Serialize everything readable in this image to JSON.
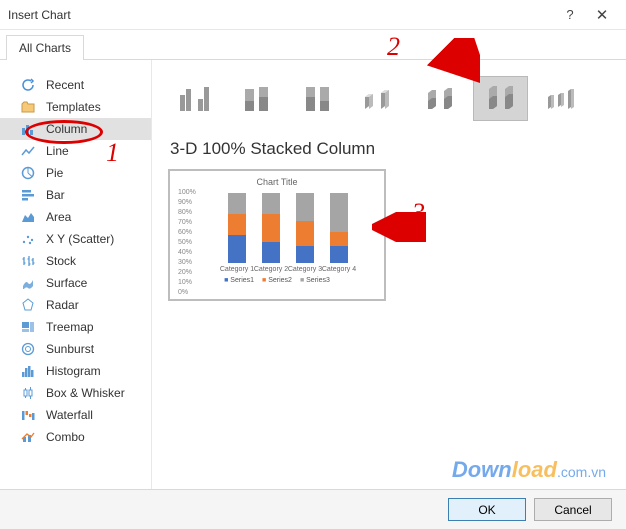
{
  "window": {
    "title": "Insert Chart",
    "help": "?",
    "close": "✕"
  },
  "tabs": [
    {
      "label": "All Charts",
      "active": true
    }
  ],
  "sidebar": {
    "items": [
      {
        "label": "Recent",
        "icon": "recent"
      },
      {
        "label": "Templates",
        "icon": "templates"
      },
      {
        "label": "Column",
        "icon": "column",
        "selected": true
      },
      {
        "label": "Line",
        "icon": "line"
      },
      {
        "label": "Pie",
        "icon": "pie"
      },
      {
        "label": "Bar",
        "icon": "bar"
      },
      {
        "label": "Area",
        "icon": "area"
      },
      {
        "label": "X Y (Scatter)",
        "icon": "scatter"
      },
      {
        "label": "Stock",
        "icon": "stock"
      },
      {
        "label": "Surface",
        "icon": "surface"
      },
      {
        "label": "Radar",
        "icon": "radar"
      },
      {
        "label": "Treemap",
        "icon": "treemap"
      },
      {
        "label": "Sunburst",
        "icon": "sunburst"
      },
      {
        "label": "Histogram",
        "icon": "histogram"
      },
      {
        "label": "Box & Whisker",
        "icon": "boxwhisker"
      },
      {
        "label": "Waterfall",
        "icon": "waterfall"
      },
      {
        "label": "Combo",
        "icon": "combo"
      }
    ]
  },
  "subtypes": {
    "selected_index": 5,
    "count": 7,
    "selected_name": "3-D 100% Stacked Column"
  },
  "preview": {
    "title_label": "3-D 100% Stacked Column",
    "chart_title": "Chart Title"
  },
  "chart_data": {
    "type": "bar",
    "stacked": "100%",
    "three_d": true,
    "categories": [
      "Category 1",
      "Category 2",
      "Category 3",
      "Category 4"
    ],
    "series": [
      {
        "name": "Series1",
        "values": [
          40,
          30,
          25,
          25
        ]
      },
      {
        "name": "Series2",
        "values": [
          30,
          40,
          35,
          20
        ]
      },
      {
        "name": "Series3",
        "values": [
          30,
          30,
          40,
          55
        ]
      }
    ],
    "ylabels": [
      "100%",
      "90%",
      "80%",
      "70%",
      "60%",
      "50%",
      "40%",
      "30%",
      "20%",
      "10%",
      "0%"
    ],
    "ylim": [
      0,
      100
    ],
    "legend_position": "bottom"
  },
  "buttons": {
    "ok": "OK",
    "cancel": "Cancel"
  },
  "annotations": {
    "n1": "1",
    "n2": "2",
    "n3": "3"
  },
  "watermark": {
    "a": "Down",
    "b": "load",
    "c": ".com.vn"
  }
}
